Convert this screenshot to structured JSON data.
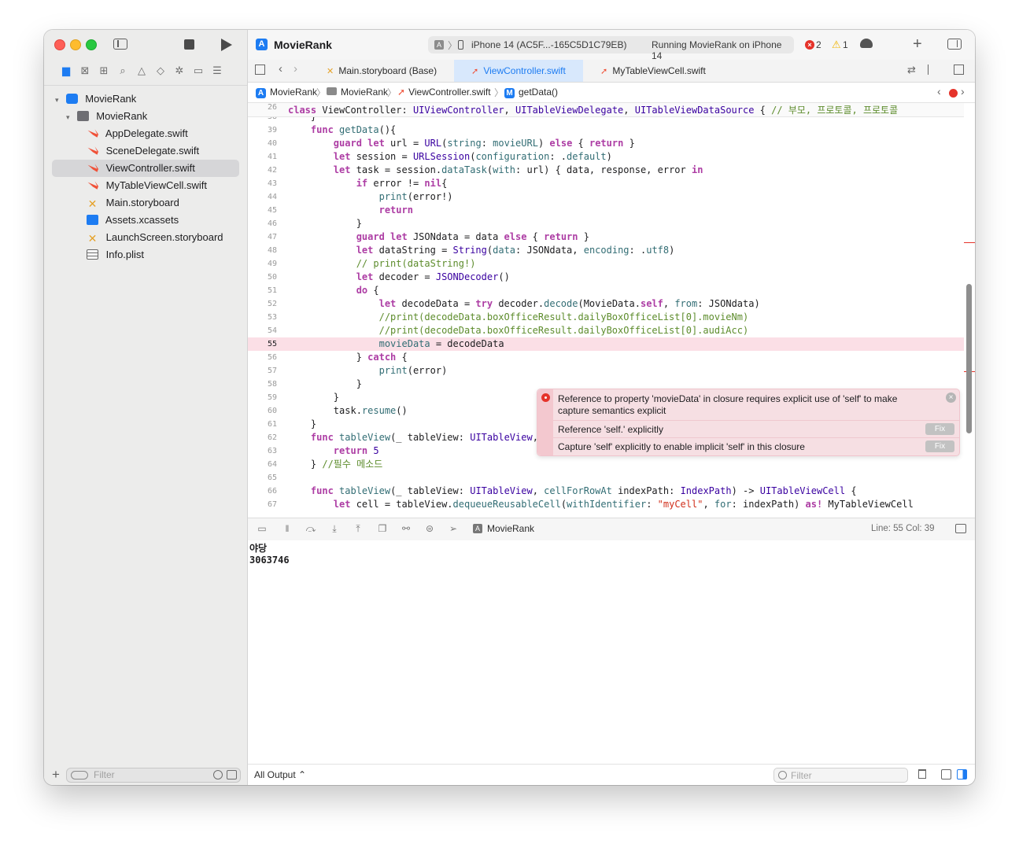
{
  "toolbar": {
    "app_title": "MovieRank",
    "device": "iPhone 14 (AC5F...-165C5D1C79EB)",
    "status": "Running MovieRank on iPhone 14",
    "error_count": "2",
    "warning_count": "1",
    "error_icon": "×",
    "warning_icon": "⚠"
  },
  "sidebar": {
    "filter_placeholder": "Filter",
    "nav_icons": [
      "folder-icon",
      "source-control-icon",
      "symbol-icon",
      "find-icon",
      "issue-icon",
      "test-icon",
      "debug-icon",
      "breakpoint-icon",
      "report-icon"
    ],
    "items": [
      {
        "label": "MovieRank",
        "icon": "project-icon",
        "indent": "level-0",
        "disclosure": "▾"
      },
      {
        "label": "MovieRank",
        "icon": "folder-icon",
        "indent": "level-1",
        "disclosure": "▾"
      },
      {
        "label": "AppDelegate.swift",
        "icon": "swift-icon",
        "indent": "level-2"
      },
      {
        "label": "SceneDelegate.swift",
        "icon": "swift-icon",
        "indent": "level-2"
      },
      {
        "label": "ViewController.swift",
        "icon": "swift-icon",
        "indent": "level-2",
        "selected": true
      },
      {
        "label": "MyTableViewCell.swift",
        "icon": "swift-icon",
        "indent": "level-2"
      },
      {
        "label": "Main.storyboard",
        "icon": "storyboard-icon",
        "indent": "level-2"
      },
      {
        "label": "Assets.xcassets",
        "icon": "assets-icon",
        "indent": "level-2"
      },
      {
        "label": "LaunchScreen.storyboard",
        "icon": "storyboard-icon",
        "indent": "level-2"
      },
      {
        "label": "Info.plist",
        "icon": "plist-icon",
        "indent": "level-2"
      }
    ]
  },
  "tabs": [
    {
      "label": "Main.storyboard (Base)",
      "icon": "storyboard-icon"
    },
    {
      "label": "ViewController.swift",
      "icon": "swift-icon",
      "active": true
    },
    {
      "label": "MyTableViewCell.swift",
      "icon": "swift-icon"
    }
  ],
  "jumpbar": {
    "project": "MovieRank",
    "group": "MovieRank",
    "file": "ViewController.swift",
    "symbol": "getData()",
    "symbol_badge": "M"
  },
  "editor": {
    "sticky": {
      "num": "26",
      "tokens": [
        [
          "kw",
          "class "
        ],
        [
          "pl",
          "ViewController: "
        ],
        [
          "ty",
          "UIViewController"
        ],
        [
          "pl",
          ", "
        ],
        [
          "ty",
          "UITableViewDelegate"
        ],
        [
          "pl",
          ", "
        ],
        [
          "ty",
          "UITableViewDataSource"
        ],
        [
          "pl",
          " { "
        ],
        [
          "cm",
          "// 부모, 프로토콜, 프로토콜"
        ]
      ]
    },
    "lines": [
      {
        "num": "38",
        "tokens": [
          [
            "pl",
            "    }"
          ]
        ]
      },
      {
        "num": "39",
        "tokens": [
          [
            "pl",
            "    "
          ],
          [
            "kw",
            "func "
          ],
          [
            "fn",
            "getData"
          ],
          [
            "pl",
            "(){"
          ]
        ]
      },
      {
        "num": "40",
        "tokens": [
          [
            "pl",
            "        "
          ],
          [
            "kw",
            "guard let "
          ],
          [
            "pl",
            "url = "
          ],
          [
            "ty",
            "URL"
          ],
          [
            "pl",
            "("
          ],
          [
            "fn",
            "string"
          ],
          [
            "pl",
            ": "
          ],
          [
            "fn",
            "movieURL"
          ],
          [
            "pl",
            ") "
          ],
          [
            "kw",
            "else"
          ],
          [
            "pl",
            " { "
          ],
          [
            "kw",
            "return"
          ],
          [
            "pl",
            " }"
          ]
        ]
      },
      {
        "num": "41",
        "tokens": [
          [
            "pl",
            "        "
          ],
          [
            "kw",
            "let "
          ],
          [
            "pl",
            "session = "
          ],
          [
            "ty",
            "URLSession"
          ],
          [
            "pl",
            "("
          ],
          [
            "fn",
            "configuration"
          ],
          [
            "pl",
            ": ."
          ],
          [
            "fn",
            "default"
          ],
          [
            "pl",
            ")"
          ]
        ]
      },
      {
        "num": "42",
        "tokens": [
          [
            "pl",
            "        "
          ],
          [
            "kw",
            "let "
          ],
          [
            "pl",
            "task = session."
          ],
          [
            "fn",
            "dataTask"
          ],
          [
            "pl",
            "("
          ],
          [
            "fn",
            "with"
          ],
          [
            "pl",
            ": url) { data, response, error "
          ],
          [
            "kw",
            "in"
          ]
        ]
      },
      {
        "num": "43",
        "tokens": [
          [
            "pl",
            "            "
          ],
          [
            "kw",
            "if "
          ],
          [
            "pl",
            "error != "
          ],
          [
            "kw",
            "nil"
          ],
          [
            "pl",
            "{"
          ]
        ]
      },
      {
        "num": "44",
        "tokens": [
          [
            "pl",
            "                "
          ],
          [
            "fn",
            "print"
          ],
          [
            "pl",
            "(error!)"
          ]
        ]
      },
      {
        "num": "45",
        "tokens": [
          [
            "pl",
            "                "
          ],
          [
            "kw",
            "return"
          ]
        ]
      },
      {
        "num": "46",
        "tokens": [
          [
            "pl",
            "            }"
          ]
        ]
      },
      {
        "num": "47",
        "tokens": [
          [
            "pl",
            "            "
          ],
          [
            "kw",
            "guard let "
          ],
          [
            "pl",
            "JSONdata = data "
          ],
          [
            "kw",
            "else"
          ],
          [
            "pl",
            " { "
          ],
          [
            "kw",
            "return"
          ],
          [
            "pl",
            " }"
          ]
        ]
      },
      {
        "num": "48",
        "tokens": [
          [
            "pl",
            "            "
          ],
          [
            "kw",
            "let "
          ],
          [
            "pl",
            "dataString = "
          ],
          [
            "ty",
            "String"
          ],
          [
            "pl",
            "("
          ],
          [
            "fn",
            "data"
          ],
          [
            "pl",
            ": JSONdata, "
          ],
          [
            "fn",
            "encoding"
          ],
          [
            "pl",
            ": ."
          ],
          [
            "fn",
            "utf8"
          ],
          [
            "pl",
            ")"
          ]
        ]
      },
      {
        "num": "49",
        "tokens": [
          [
            "pl",
            "            "
          ],
          [
            "cm",
            "// print(dataString!)"
          ]
        ]
      },
      {
        "num": "50",
        "tokens": [
          [
            "pl",
            "            "
          ],
          [
            "kw",
            "let "
          ],
          [
            "pl",
            "decoder = "
          ],
          [
            "ty",
            "JSONDecoder"
          ],
          [
            "pl",
            "()"
          ]
        ]
      },
      {
        "num": "51",
        "tokens": [
          [
            "pl",
            "            "
          ],
          [
            "kw",
            "do"
          ],
          [
            "pl",
            " {"
          ]
        ]
      },
      {
        "num": "52",
        "tokens": [
          [
            "pl",
            "                "
          ],
          [
            "kw",
            "let "
          ],
          [
            "pl",
            "decodeData = "
          ],
          [
            "kw",
            "try "
          ],
          [
            "pl",
            "decoder."
          ],
          [
            "fn",
            "decode"
          ],
          [
            "pl",
            "(MovieData."
          ],
          [
            "kw",
            "self"
          ],
          [
            "pl",
            ", "
          ],
          [
            "fn",
            "from"
          ],
          [
            "pl",
            ": JSONdata)"
          ]
        ]
      },
      {
        "num": "53",
        "tokens": [
          [
            "pl",
            "                "
          ],
          [
            "cm",
            "//print(decodeData.boxOfficeResult.dailyBoxOfficeList[0].movieNm)"
          ]
        ]
      },
      {
        "num": "54",
        "tokens": [
          [
            "pl",
            "                "
          ],
          [
            "cm",
            "//print(decodeData.boxOfficeResult.dailyBoxOfficeList[0].audiAcc)"
          ]
        ]
      },
      {
        "num": "55",
        "error": true,
        "tokens": [
          [
            "pl",
            "                "
          ],
          [
            "fn",
            "movieData"
          ],
          [
            "pl",
            " = decodeData"
          ]
        ]
      },
      {
        "num": "56",
        "tokens": [
          [
            "pl",
            "            } "
          ],
          [
            "kw",
            "catch"
          ],
          [
            "pl",
            " {"
          ]
        ]
      },
      {
        "num": "57",
        "tokens": [
          [
            "pl",
            "                "
          ],
          [
            "fn",
            "print"
          ],
          [
            "pl",
            "(error)"
          ]
        ]
      },
      {
        "num": "58",
        "tokens": [
          [
            "pl",
            "            }"
          ]
        ]
      },
      {
        "num": "59",
        "tokens": [
          [
            "pl",
            "        }"
          ]
        ]
      },
      {
        "num": "60",
        "tokens": [
          [
            "pl",
            "        task."
          ],
          [
            "fn",
            "resume"
          ],
          [
            "pl",
            "()"
          ]
        ]
      },
      {
        "num": "61",
        "tokens": [
          [
            "pl",
            "    }"
          ]
        ]
      },
      {
        "num": "62",
        "tokens": [
          [
            "pl",
            "    "
          ],
          [
            "kw",
            "func "
          ],
          [
            "fn",
            "tableView"
          ],
          [
            "pl",
            "(_ tableView: "
          ],
          [
            "ty",
            "UITableView"
          ],
          [
            "pl",
            ", "
          ],
          [
            "fn",
            "numberOfRowsInSection"
          ],
          [
            "pl",
            " section: "
          ],
          [
            "ty",
            "Int"
          ],
          [
            "pl",
            ") -> "
          ],
          [
            "ty",
            "Int"
          ],
          [
            "pl",
            " {"
          ]
        ]
      },
      {
        "num": "63",
        "tokens": [
          [
            "pl",
            "        "
          ],
          [
            "kw",
            "return "
          ],
          [
            "ty",
            "5"
          ]
        ]
      },
      {
        "num": "64",
        "tokens": [
          [
            "pl",
            "    } "
          ],
          [
            "cm",
            "//필수 메소드"
          ]
        ]
      },
      {
        "num": "65",
        "tokens": [
          [
            "pl",
            ""
          ]
        ]
      },
      {
        "num": "66",
        "tokens": [
          [
            "pl",
            "    "
          ],
          [
            "kw",
            "func "
          ],
          [
            "fn",
            "tableView"
          ],
          [
            "pl",
            "(_ tableView: "
          ],
          [
            "ty",
            "UITableView"
          ],
          [
            "pl",
            ", "
          ],
          [
            "fn",
            "cellForRowAt"
          ],
          [
            "pl",
            " indexPath: "
          ],
          [
            "ty",
            "IndexPath"
          ],
          [
            "pl",
            ") -> "
          ],
          [
            "ty",
            "UITableViewCell"
          ],
          [
            "pl",
            " {"
          ]
        ]
      },
      {
        "num": "67",
        "tokens": [
          [
            "pl",
            "        "
          ],
          [
            "kw",
            "let "
          ],
          [
            "pl",
            "cell = tableView."
          ],
          [
            "fn",
            "dequeueReusableCell"
          ],
          [
            "pl",
            "("
          ],
          [
            "fn",
            "withIdentifier"
          ],
          [
            "pl",
            ": "
          ],
          [
            "st",
            "\"myCell\""
          ],
          [
            "pl",
            ", "
          ],
          [
            "fn",
            "for"
          ],
          [
            "pl",
            ": indexPath) "
          ],
          [
            "kw",
            "as!"
          ],
          [
            "pl",
            " MyTableViewCell"
          ]
        ]
      }
    ]
  },
  "issue": {
    "message": "Reference to property 'movieData' in closure requires explicit use of 'self' to make capture semantics explicit",
    "fixes": [
      {
        "text": "Reference 'self.' explicitly",
        "button": "Fix"
      },
      {
        "text": "Capture 'self' explicitly to enable implicit 'self' in this closure",
        "button": "Fix"
      }
    ],
    "close": "×"
  },
  "debugbar": {
    "target": "MovieRank",
    "position": "Line: 55  Col: 39"
  },
  "console": {
    "lines": [
      "야당",
      "3063746"
    ]
  },
  "bottom": {
    "output_select": "All Output ⌃",
    "filter_placeholder": "Filter"
  },
  "colors": {
    "accent": "#1d7cf2",
    "error": "#e5332a",
    "error_line_bg": "#fbdfe6",
    "keyword": "#ad3da4",
    "comment": "#5d8c2c"
  }
}
